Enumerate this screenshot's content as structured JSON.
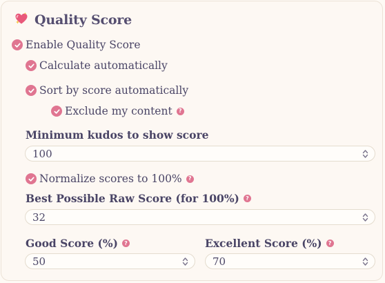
{
  "section": {
    "title": "Quality Score",
    "icon": "heart-sparkle-icon"
  },
  "options": {
    "enable": "Enable Quality Score",
    "calculate": "Calculate automatically",
    "sort": "Sort by score automatically",
    "exclude": "Exclude my content",
    "normalize": "Normalize scores to 100%"
  },
  "fields": {
    "min_kudos": {
      "label": "Minimum kudos to show score",
      "value": "100"
    },
    "best_raw": {
      "label": "Best Possible Raw Score (for 100%)",
      "value": "32"
    },
    "good": {
      "label": "Good Score (%)",
      "value": "50"
    },
    "excellent": {
      "label": "Excellent Score (%)",
      "value": "70"
    }
  },
  "help_glyph": "?",
  "colors": {
    "accent": "#e07591",
    "text": "#4a4566",
    "background": "#fdf8f3",
    "border": "#ece2d6"
  }
}
